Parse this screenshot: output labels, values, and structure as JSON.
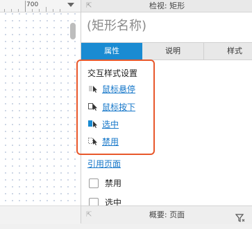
{
  "canvas": {
    "ruler_value": "700"
  },
  "panel": {
    "header_title": "检视: 矩形",
    "name_placeholder": "(矩形名称)",
    "tabs": [
      {
        "label": "属性",
        "active": true
      },
      {
        "label": "说明",
        "active": false
      },
      {
        "label": "样式",
        "active": false
      }
    ],
    "interaction_styles": {
      "title": "交互样式设置",
      "items": [
        {
          "label": "鼠标悬停",
          "icon": "cursor-hover-icon"
        },
        {
          "label": "鼠标按下",
          "icon": "cursor-press-icon"
        },
        {
          "label": "选中",
          "icon": "cursor-selected-icon"
        },
        {
          "label": "禁用",
          "icon": "cursor-disabled-icon"
        }
      ]
    },
    "reference_page_link": "引用页面",
    "checkboxes": [
      {
        "label": "禁用",
        "checked": false
      },
      {
        "label": "选中",
        "checked": false
      }
    ],
    "footer_title": "概要: 页面"
  },
  "colors": {
    "accent": "#1a8bd2",
    "link": "#1677c9",
    "highlight_border": "#e8572a"
  }
}
